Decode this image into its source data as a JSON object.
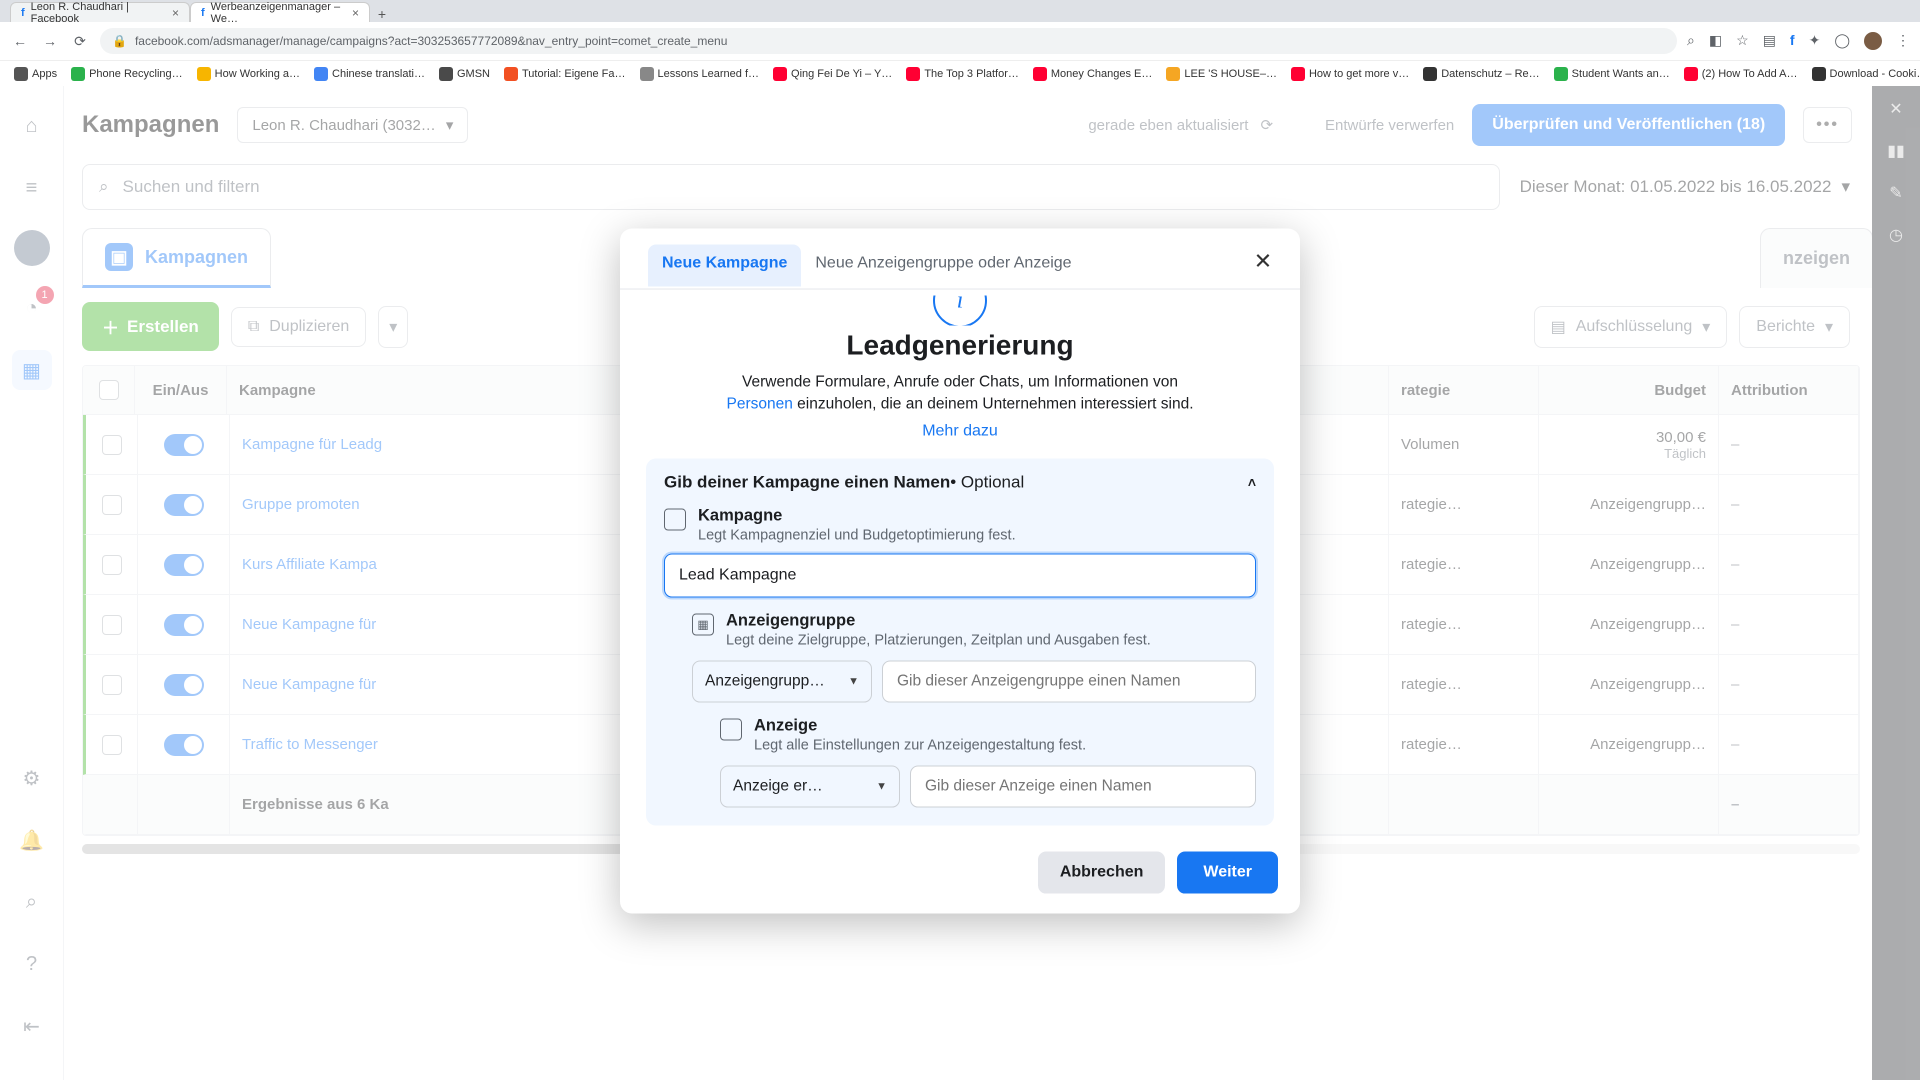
{
  "browser": {
    "tabs": [
      {
        "title": "Leon R. Chaudhari | Facebook"
      },
      {
        "title": "Werbeanzeigenmanager – We…"
      }
    ],
    "url": "facebook.com/adsmanager/manage/campaigns?act=303253657772089&nav_entry_point=comet_create_menu",
    "bookmarks": [
      {
        "label": "Apps",
        "color": "#555"
      },
      {
        "label": "Phone Recycling…",
        "color": "#2bb24c"
      },
      {
        "label": "How Working a…",
        "color": "#f7b500"
      },
      {
        "label": "Chinese translati…",
        "color": "#4285f4"
      },
      {
        "label": "GMSN",
        "color": "#4a4a4a"
      },
      {
        "label": "Tutorial: Eigene Fa…",
        "color": "#f25022"
      },
      {
        "label": "Lessons Learned f…",
        "color": "#888"
      },
      {
        "label": "Qing Fei De Yi – Y…",
        "color": "#ff0033"
      },
      {
        "label": "The Top 3 Platfor…",
        "color": "#ff0033"
      },
      {
        "label": "Money Changes E…",
        "color": "#ff0033"
      },
      {
        "label": "LEE 'S HOUSE–…",
        "color": "#f5a623"
      },
      {
        "label": "How to get more v…",
        "color": "#ff0033"
      },
      {
        "label": "Datenschutz – Re…",
        "color": "#333"
      },
      {
        "label": "Student Wants an…",
        "color": "#2bb24c"
      },
      {
        "label": "(2) How To Add A…",
        "color": "#ff0033"
      },
      {
        "label": "Download - Cooki…",
        "color": "#333"
      }
    ]
  },
  "header": {
    "page_title": "Kampagnen",
    "account_pill": "Leon R. Chaudhari (3032…",
    "refresh_text": "gerade eben aktualisiert",
    "drafts_text": "Entwürfe verwerfen",
    "publish_label": "Überprüfen und Veröffentlichen (18)"
  },
  "search": {
    "placeholder": "Suchen und filtern",
    "date_range": "Dieser Monat: 01.05.2022 bis 16.05.2022"
  },
  "level_tabs": {
    "campaigns": "Kampagnen",
    "ads": "nzeigen"
  },
  "toolbar": {
    "create": "Erstellen",
    "duplicate": "Duplizieren",
    "breakdown": "Aufschlüsselung",
    "reports": "Berichte"
  },
  "table": {
    "headers": {
      "toggle": "Ein/Aus",
      "name": "Kampagne",
      "strategy": "rategie",
      "budget": "Budget",
      "attribution": "Attribution"
    },
    "rows": [
      {
        "name": "Kampagne für Leadg",
        "strategy": "Volumen",
        "budget": "30,00 €",
        "budget_sub": "Täglich",
        "attr": "–"
      },
      {
        "name": "Gruppe promoten",
        "strategy": "rategie…",
        "budget": "Anzeigengrupp…",
        "attr": "–"
      },
      {
        "name": "Kurs Affiliate Kampa",
        "strategy": "rategie…",
        "budget": "Anzeigengrupp…",
        "attr": "–"
      },
      {
        "name": "Neue Kampagne für ",
        "strategy": "rategie…",
        "budget": "Anzeigengrupp…",
        "attr": "–"
      },
      {
        "name": "Neue Kampagne für ",
        "strategy": "rategie…",
        "budget": "Anzeigengrupp…",
        "attr": "–"
      },
      {
        "name": "Traffic to Messenger",
        "strategy": "rategie…",
        "budget": "Anzeigengrupp…",
        "attr": "–"
      }
    ],
    "summary": {
      "label": "Ergebnisse aus 6 Ka",
      "attr": "–"
    }
  },
  "modal": {
    "tab_new_campaign": "Neue Kampagne",
    "tab_new_adset": "Neue Anzeigengruppe oder Anzeige",
    "hero_title": "Leadgenerierung",
    "hero_line1": "Verwende Formulare, Anrufe oder Chats, um Informationen von",
    "hero_highlight": "Personen",
    "hero_line2": " einzuholen, die an deinem Unternehmen interessiert sind.",
    "learn_more": "Mehr dazu",
    "panel_title_main": "Gib deiner Kampagne einen Namen",
    "panel_title_opt": " • Optional",
    "campaign": {
      "title": "Kampagne",
      "sub": "Legt Kampagnenziel und Budgetoptimierung fest.",
      "value": "Lead Kampagne"
    },
    "adset": {
      "title": "Anzeigengruppe",
      "sub": "Legt deine Zielgruppe, Platzierungen, Zeitplan und Ausgaben fest.",
      "select": "Anzeigengrupp…",
      "placeholder": "Gib dieser Anzeigengruppe einen Namen"
    },
    "ad": {
      "title": "Anzeige",
      "sub": "Legt alle Einstellungen zur Anzeigengestaltung fest.",
      "select": "Anzeige er…",
      "placeholder": "Gib dieser Anzeige einen Namen"
    },
    "cancel": "Abbrechen",
    "next": "Weiter"
  },
  "rail": {
    "badge": "1"
  }
}
